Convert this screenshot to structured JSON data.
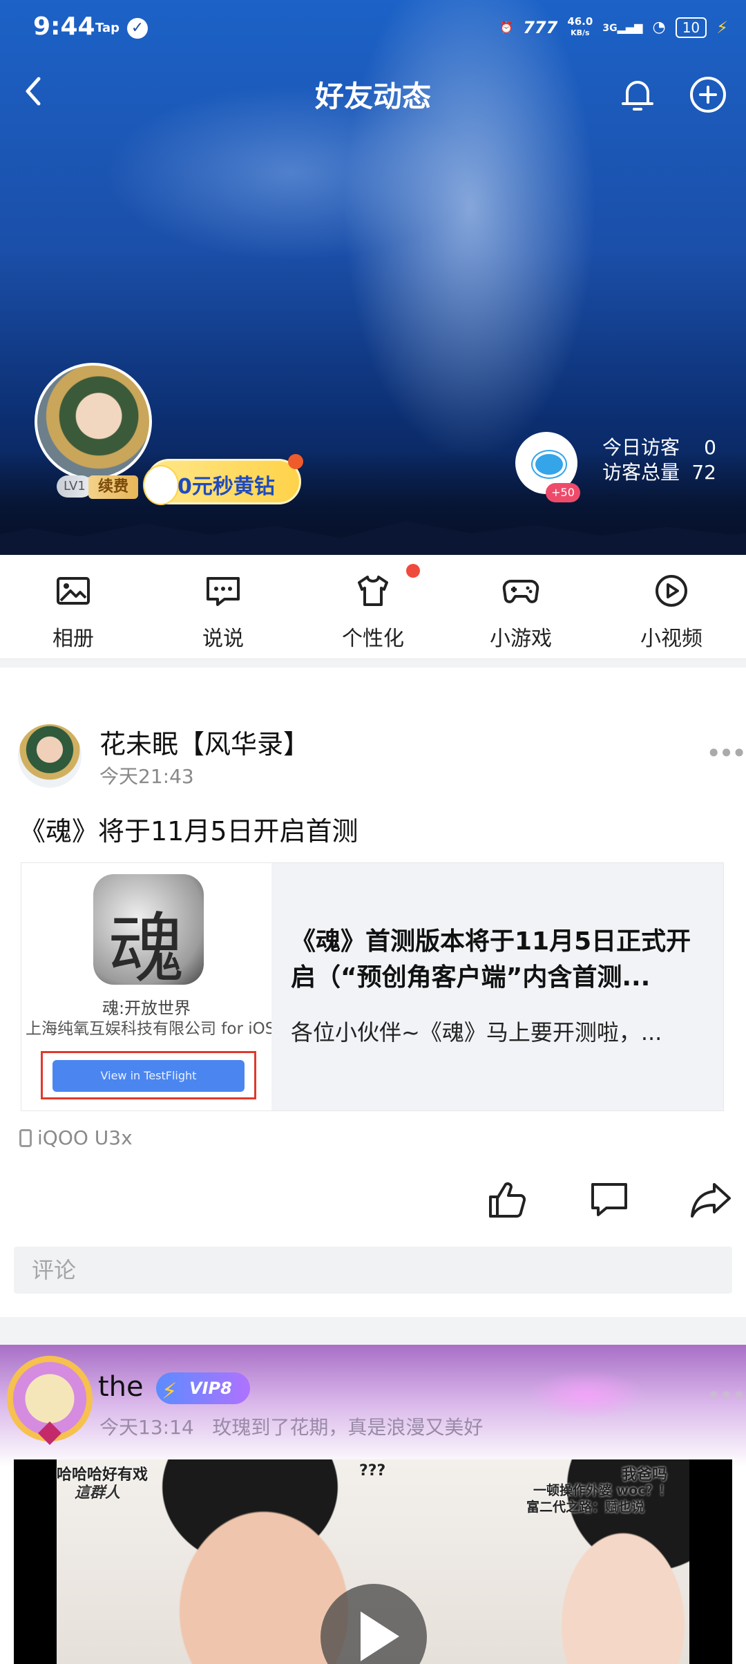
{
  "status_bar": {
    "time": "9:44",
    "tap": "Tap",
    "speed_top": "46.0",
    "speed_unit": "KB/s",
    "net": "3G",
    "battery": "10"
  },
  "header": {
    "title": "好友动态"
  },
  "profile": {
    "level": "LV1",
    "renew": "续费",
    "promo": "0元秒黄钻",
    "visitor_badge": "+50",
    "today_label": "今日访客",
    "today_value": "0",
    "total_label": "访客总量",
    "total_value": "72"
  },
  "nav": {
    "items": [
      {
        "label": "相册",
        "icon": "photo-icon"
      },
      {
        "label": "说说",
        "icon": "message-icon"
      },
      {
        "label": "个性化",
        "icon": "shirt-icon"
      },
      {
        "label": "小游戏",
        "icon": "gamepad-icon"
      },
      {
        "label": "小视频",
        "icon": "play-circle-icon"
      }
    ]
  },
  "post1": {
    "name": "花未眠【风华录】",
    "time": "今天21:43",
    "text": "《魂》将于11月5日开启首测",
    "card": {
      "app_name": "魂:开放世界",
      "company": "上海纯氧互娱科技有限公司 for iOS",
      "button": "View in TestFlight",
      "title": "《魂》首测版本将于11月5日正式开启（“预创角客户端”内含首测...",
      "desc": "各位小伙伴~《魂》马上要开测啦，..."
    },
    "device": "iQOO U3x",
    "comment_placeholder": "评论"
  },
  "post2": {
    "name": "the",
    "vip": "VIP8",
    "time": "今天13:14",
    "caption": "玫瑰到了花期，真是浪漫又美好",
    "video_captions": [
      "哈哈哈好有戏",
      "這群人",
      "???",
      "我爸吗",
      "一顿操作外婆 woc？！",
      "富二代之路：赋也说"
    ]
  }
}
